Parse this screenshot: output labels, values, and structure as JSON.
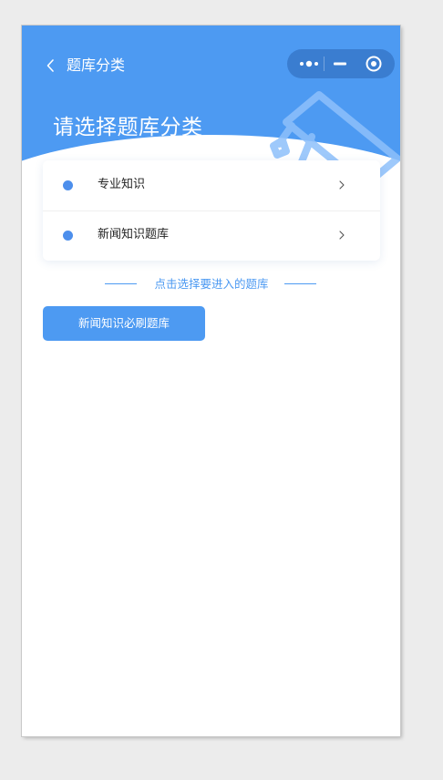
{
  "navbar": {
    "title": "题库分类",
    "back_icon": "chevron-left-icon",
    "capsule": {
      "more_icon": "more-dots-icon",
      "minimize_icon": "minimize-icon",
      "close_icon": "target-close-icon"
    }
  },
  "hero": {
    "heading": "请选择题库分类",
    "decoration_icon": "graduation-cap-icon"
  },
  "categories": [
    {
      "label": "专业知识",
      "icon": "bullet-dot-icon",
      "arrow_icon": "chevron-right-icon"
    },
    {
      "label": "新闻知识题库",
      "icon": "bullet-dot-icon",
      "arrow_icon": "chevron-right-icon"
    }
  ],
  "hint": {
    "text": "点击选择要进入的题库"
  },
  "action_button": {
    "label": "新闻知识必刷题库"
  },
  "colors": {
    "primary": "#4d9af2",
    "capsule": "#3a7dd0",
    "dot": "#4d8fec",
    "background": "#ececec"
  }
}
